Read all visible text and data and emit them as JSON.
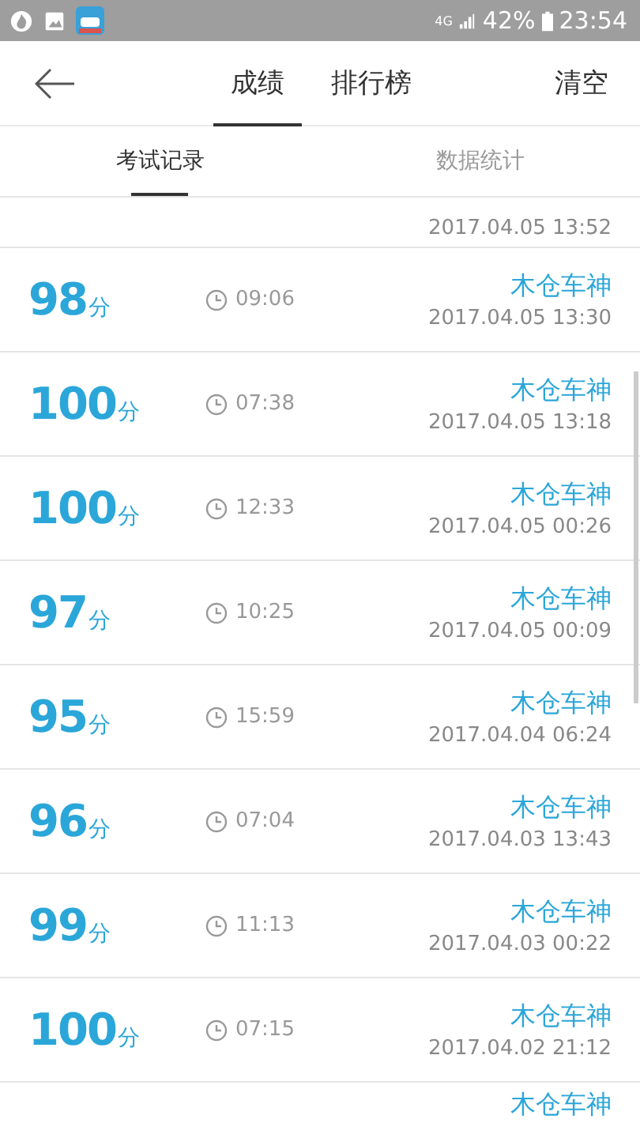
{
  "status_bar": {
    "network": "4G",
    "battery": "42%",
    "time": "23:54"
  },
  "header": {
    "tabs": [
      {
        "label": "成绩",
        "selected": true
      },
      {
        "label": "排行榜",
        "selected": false
      }
    ],
    "action": "清空"
  },
  "sub_tabs": [
    {
      "label": "考试记录",
      "selected": true
    },
    {
      "label": "数据统计",
      "selected": false
    }
  ],
  "records": [
    {
      "date": "2017.04.05 13:52"
    },
    {
      "score": "98",
      "unit": "分",
      "duration": "09:06",
      "name": "木仓车神",
      "date": "2017.04.05 13:30"
    },
    {
      "score": "100",
      "unit": "分",
      "duration": "07:38",
      "name": "木仓车神",
      "date": "2017.04.05 13:18"
    },
    {
      "score": "100",
      "unit": "分",
      "duration": "12:33",
      "name": "木仓车神",
      "date": "2017.04.05 00:26"
    },
    {
      "score": "97",
      "unit": "分",
      "duration": "10:25",
      "name": "木仓车神",
      "date": "2017.04.05 00:09"
    },
    {
      "score": "95",
      "unit": "分",
      "duration": "15:59",
      "name": "木仓车神",
      "date": "2017.04.04 06:24"
    },
    {
      "score": "96",
      "unit": "分",
      "duration": "07:04",
      "name": "木仓车神",
      "date": "2017.04.03 13:43"
    },
    {
      "score": "99",
      "unit": "分",
      "duration": "11:13",
      "name": "木仓车神",
      "date": "2017.04.03 00:22"
    },
    {
      "score": "100",
      "unit": "分",
      "duration": "07:15",
      "name": "木仓车神",
      "date": "2017.04.02 21:12"
    },
    {
      "name": "木仓车神"
    }
  ]
}
